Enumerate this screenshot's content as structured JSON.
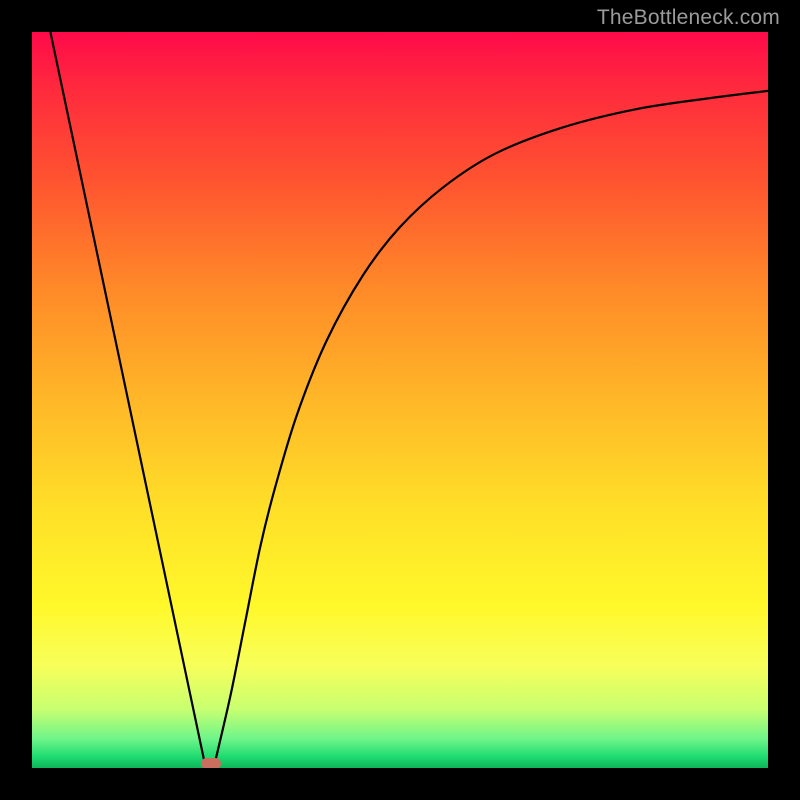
{
  "watermark": "TheBottleneck.com",
  "chart_data": {
    "type": "line",
    "xlim": [
      0,
      1
    ],
    "ylim": [
      0,
      1
    ],
    "xlabel": "",
    "ylabel": "",
    "title": "",
    "gradient": {
      "top": "#ff0a4a",
      "bottom": "#0fb45a",
      "description": "red-to-green vertical gradient background"
    },
    "series": [
      {
        "name": "left-line",
        "type": "line",
        "x": [
          0.025,
          0.235
        ],
        "y": [
          1.0,
          0.005
        ]
      },
      {
        "name": "right-curve",
        "type": "line",
        "x": [
          0.248,
          0.27,
          0.29,
          0.31,
          0.33,
          0.36,
          0.4,
          0.45,
          0.5,
          0.56,
          0.63,
          0.72,
          0.82,
          0.92,
          1.0
        ],
        "y": [
          0.005,
          0.1,
          0.2,
          0.3,
          0.38,
          0.48,
          0.58,
          0.67,
          0.735,
          0.79,
          0.835,
          0.87,
          0.895,
          0.91,
          0.92
        ]
      }
    ],
    "marker": {
      "name": "min-point",
      "x": 0.243,
      "y": 0.006,
      "width_frac": 0.028,
      "height_frac": 0.015,
      "color": "#ca6f60"
    }
  }
}
